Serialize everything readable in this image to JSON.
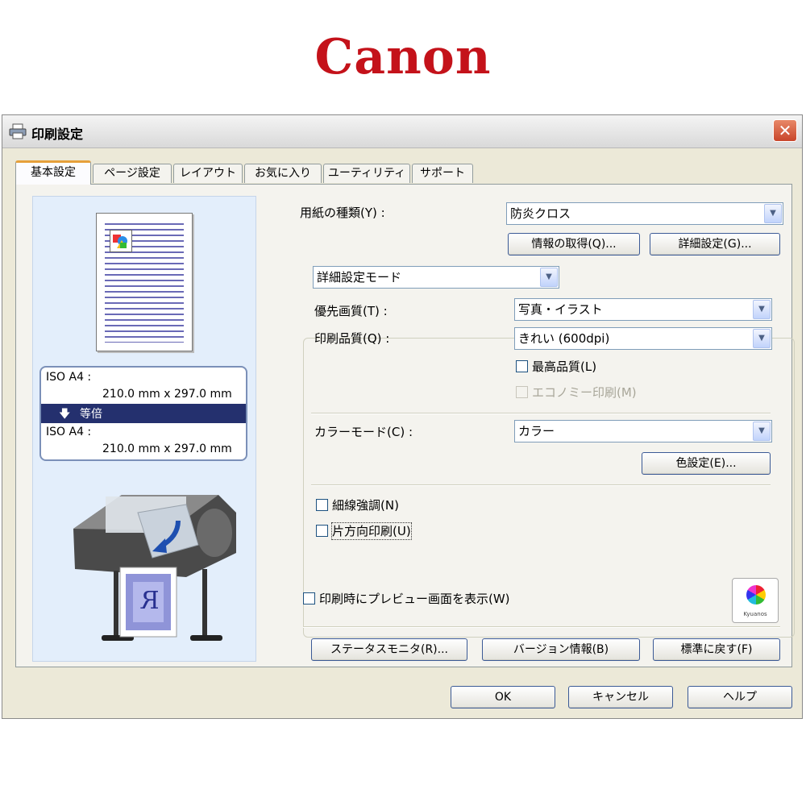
{
  "brand": {
    "logo_text": "Canon",
    "logo_color": "#c4121a"
  },
  "window": {
    "title": "印刷設定",
    "close_label": "✕",
    "icons": {
      "title": "printer-icon",
      "close": "close-icon"
    }
  },
  "tabs": [
    {
      "label": "基本設定",
      "active": true
    },
    {
      "label": "ページ設定",
      "active": false
    },
    {
      "label": "レイアウト",
      "active": false
    },
    {
      "label": "お気に入り",
      "active": false
    },
    {
      "label": "ユーティリティ",
      "active": false
    },
    {
      "label": "サポート",
      "active": false
    }
  ],
  "preview": {
    "input_size_name": "ISO A4 :",
    "input_size_dims": "210.0 mm x 297.0 mm",
    "scale_label": "等倍",
    "scale_icon": "arrow-down-icon",
    "output_size_name": "ISO A4 :",
    "output_size_dims": "210.0 mm x 297.0 mm",
    "paper_letter": "R"
  },
  "media": {
    "label": "用紙の種類(Y) :",
    "value": "防炎クロス",
    "get_info_button": "情報の取得(Q)...",
    "detail_settings_button": "詳細設定(G)..."
  },
  "mode": {
    "value": "詳細設定モード"
  },
  "quality": {
    "priority_label": "優先画質(T) :",
    "priority_value": "写真・イラスト",
    "print_quality_label": "印刷品質(Q) :",
    "print_quality_value": "きれい (600dpi)",
    "highest_quality": {
      "label": "最高品質(L)",
      "checked": false
    },
    "economy_print": {
      "label": "エコノミー印刷(M)",
      "checked": false,
      "disabled": true
    }
  },
  "color": {
    "mode_label": "カラーモード(C) :",
    "mode_value": "カラー",
    "color_settings_button": "色設定(E)..."
  },
  "options": {
    "line_emphasis": {
      "label": "細線強調(N)",
      "checked": false
    },
    "unidirectional": {
      "label": "片方向印刷(U)",
      "checked": false
    },
    "preview_on_print": {
      "label": "印刷時にプレビュー画面を表示(W)",
      "checked": false
    }
  },
  "kyuanos": {
    "label": "Kyuanos"
  },
  "bottom_buttons": {
    "status_monitor": "ステータスモニタ(R)...",
    "version_info": "バージョン情報(B)",
    "restore_defaults": "標準に戻す(F)"
  },
  "dialog_buttons": {
    "ok": "OK",
    "cancel": "キャンセル",
    "help": "ヘルプ"
  }
}
